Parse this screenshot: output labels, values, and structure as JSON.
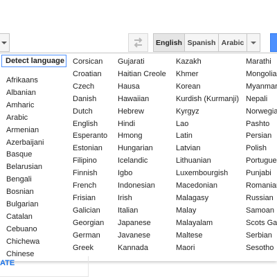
{
  "toolbar": {
    "swap_icon": "swap-arrows-icon",
    "target_languages": [
      "English",
      "Spanish",
      "Arabic"
    ],
    "active_target": "English"
  },
  "menu": {
    "detect_label": "Detect language",
    "columns": [
      [
        "Afrikaans",
        "Albanian",
        "Amharic",
        "Arabic",
        "Armenian",
        "Azerbaijani",
        "Basque",
        "Belarusian",
        "Bengali",
        "Bosnian",
        "Bulgarian",
        "Catalan",
        "Cebuano",
        "Chichewa",
        "Chinese"
      ],
      [
        "Corsican",
        "Croatian",
        "Czech",
        "Danish",
        "Dutch",
        "English",
        "Esperanto",
        "Estonian",
        "Filipino",
        "Finnish",
        "French",
        "Frisian",
        "Galician",
        "Georgian",
        "German",
        "Greek"
      ],
      [
        "Gujarati",
        "Haitian Creole",
        "Hausa",
        "Hawaiian",
        "Hebrew",
        "Hindi",
        "Hmong",
        "Hungarian",
        "Icelandic",
        "Igbo",
        "Indonesian",
        "Irish",
        "Italian",
        "Japanese",
        "Javanese",
        "Kannada"
      ],
      [
        "Kazakh",
        "Khmer",
        "Korean",
        "Kurdish (Kurmanji)",
        "Kyrgyz",
        "Lao",
        "Latin",
        "Latvian",
        "Lithuanian",
        "Luxembourgish",
        "Macedonian",
        "Malagasy",
        "Malay",
        "Malayalam",
        "Maltese",
        "Maori"
      ],
      [
        "Marathi",
        "Mongolian",
        "Myanmar (B",
        "Nepali",
        "Norwegian",
        "Pashto",
        "Persian",
        "Polish",
        "Portugues",
        "Punjabi",
        "Romanian",
        "Russian",
        "Samoan",
        "Scots Gae",
        "Serbian",
        "Sesotho"
      ]
    ]
  },
  "left_panel": {
    "translate_label_partial": "ATE"
  },
  "colors": {
    "accent": "#4d90fe",
    "link": "#1a73e8"
  }
}
